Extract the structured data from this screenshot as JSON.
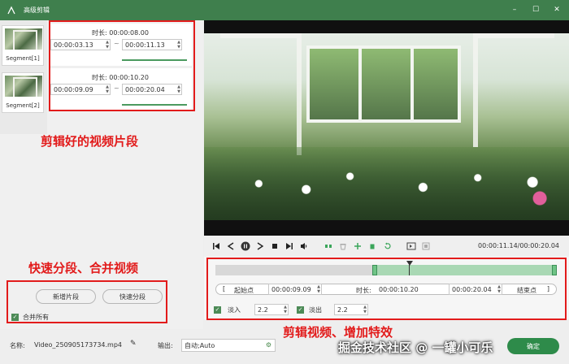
{
  "window": {
    "title": "高级剪辑"
  },
  "segments": [
    {
      "label": "Segment[1]",
      "duration_label": "时长:",
      "duration": "00:00:08.00",
      "start": "00:00:03.13",
      "end": "00:00:11.13"
    },
    {
      "label": "Segment[2]",
      "duration_label": "时长:",
      "duration": "00:00:10.20",
      "start": "00:00:09.09",
      "end": "00:00:20.04"
    }
  ],
  "annotations": {
    "segments": "剪辑好的视频片段",
    "split": "快速分段、合并视频",
    "edit": "剪辑视频、增加特效"
  },
  "left_buttons": {
    "add_segment": "新增片段",
    "quick_split": "快速分段",
    "merge_all": "合并所有"
  },
  "player": {
    "time": "00:00:11.14/00:00:20.04"
  },
  "timeline": {
    "start_label": "起始点",
    "start": "00:00:09.09",
    "duration_label": "时长:",
    "duration": "00:00:10.20",
    "end": "00:00:20.04",
    "end_label": "结束点",
    "fade_in_label": "淡入",
    "fade_in": "2.2",
    "fade_out_label": "淡出",
    "fade_out": "2.2"
  },
  "footer": {
    "name_label": "名称:",
    "name": "Video_250905173734.mp4",
    "output_label": "输出:",
    "output": "自动;Auto",
    "confirm": "确定"
  },
  "watermark": "掘金技术社区 @ 一罐小可乐",
  "colors": {
    "accent": "#3f7f4d",
    "highlight": "#e21b1b"
  }
}
